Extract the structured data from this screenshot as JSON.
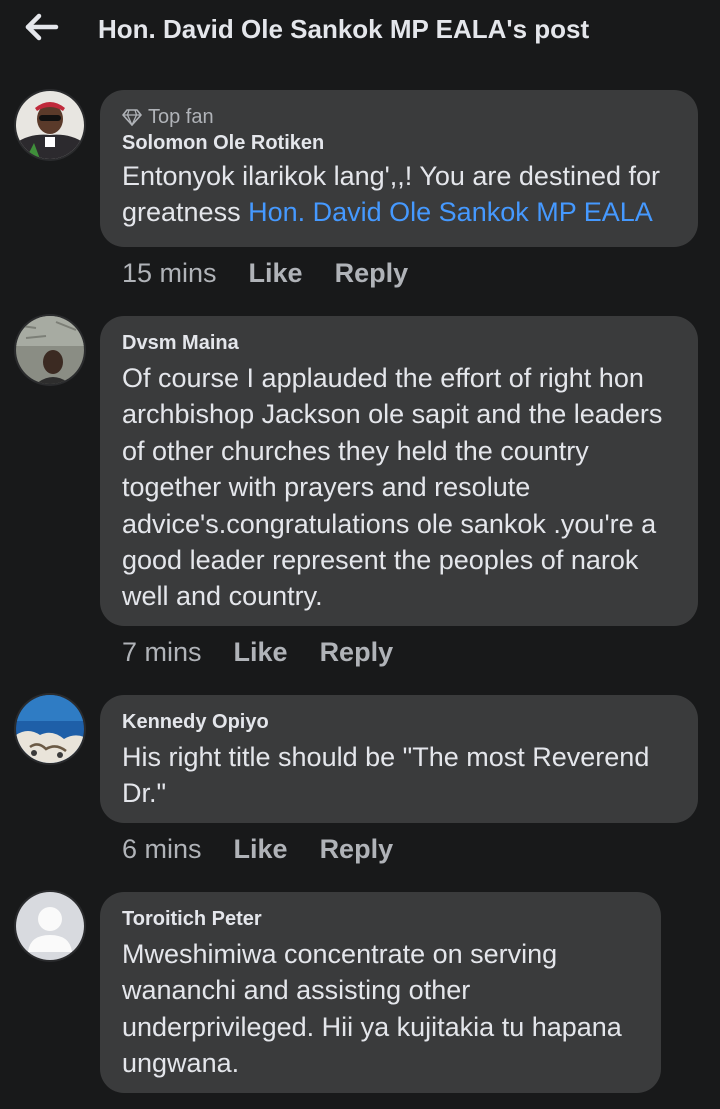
{
  "header": {
    "title": "Hon. David Ole Sankok MP EALA's post",
    "back_icon": "arrow-left-icon"
  },
  "colors": {
    "background": "#18191a",
    "bubble": "#3a3b3c",
    "mention": "#4599ff",
    "secondary_text": "#b0b3b8"
  },
  "comments": [
    {
      "badge": "Top fan",
      "badge_icon": "diamond-icon",
      "author": "Solomon Ole Rotiken",
      "text": "Entonyok ilarikok lang',,! You are destined for greatness",
      "mention": "Hon. David Ole Sankok MP EALA",
      "time": "15 mins",
      "like": "Like",
      "reply": "Reply"
    },
    {
      "author": "Dvsm Maina",
      "text": "Of course I applauded the  effort of right hon archbishop Jackson ole sapit and the leaders of other churches they held the country together with prayers and resolute advice's.congratulations ole sankok .you're a good leader represent the peoples of narok well and country.",
      "time": "7 mins",
      "like": "Like",
      "reply": "Reply"
    },
    {
      "author": "Kennedy Opiyo",
      "text": "His  right title should be \"The most Reverend Dr.\"",
      "time": "6 mins",
      "like": "Like",
      "reply": "Reply"
    },
    {
      "author": "Toroitich Peter",
      "text": "Mweshimiwa concentrate on serving wananchi and assisting other underprivileged. Hii ya kujitakia tu hapana ungwana."
    }
  ]
}
